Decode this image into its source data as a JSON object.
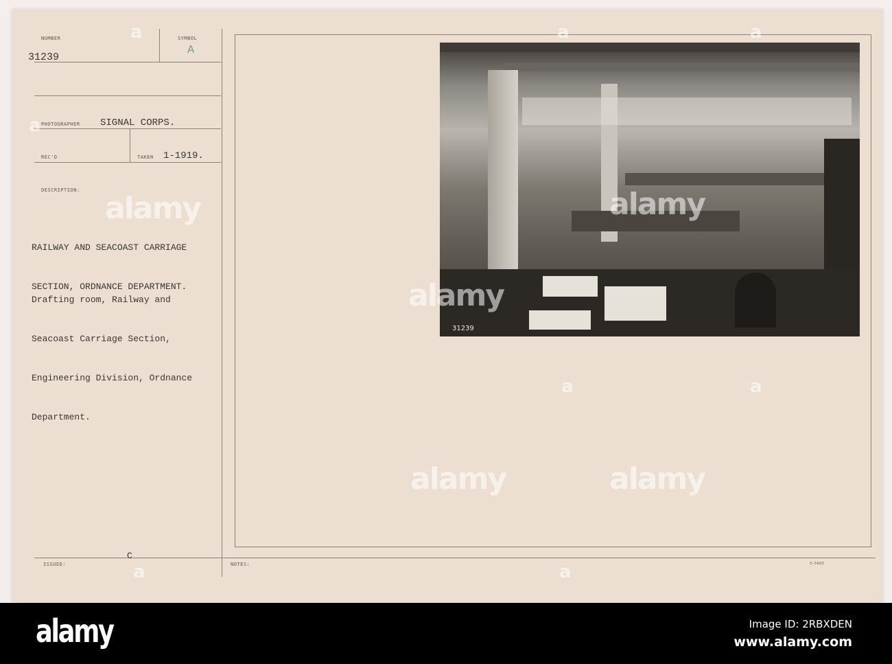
{
  "card": {
    "number_label": "NUMBER",
    "number": "31239",
    "symbol_label": "SYMBOL",
    "symbol": "A",
    "photographer_label": "PHOTOGRAPHER",
    "photographer": "SIGNAL CORPS.",
    "recd_label": "REC'D",
    "taken_label": "TAKEN",
    "taken": "1-1919.",
    "description_label": "DESCRIPTION:",
    "title_lines": [
      "RAILWAY AND SEACOAST CARRIAGE",
      "SECTION, ORDNANCE DEPARTMENT."
    ],
    "description_lines": [
      "Drafting room, Railway and",
      "Seacoast Carriage Section,",
      "Engineering Division, Ordnance",
      "Department."
    ],
    "issued_label": "ISSUED:",
    "issued_mark": "C",
    "notes_label": "NOTES:",
    "form_code": "3—5603"
  },
  "photo": {
    "caption": "31239"
  },
  "watermark": {
    "text": "alamy",
    "image_id": "Image ID: 2RBXDEN",
    "site": "www.alamy.com"
  }
}
